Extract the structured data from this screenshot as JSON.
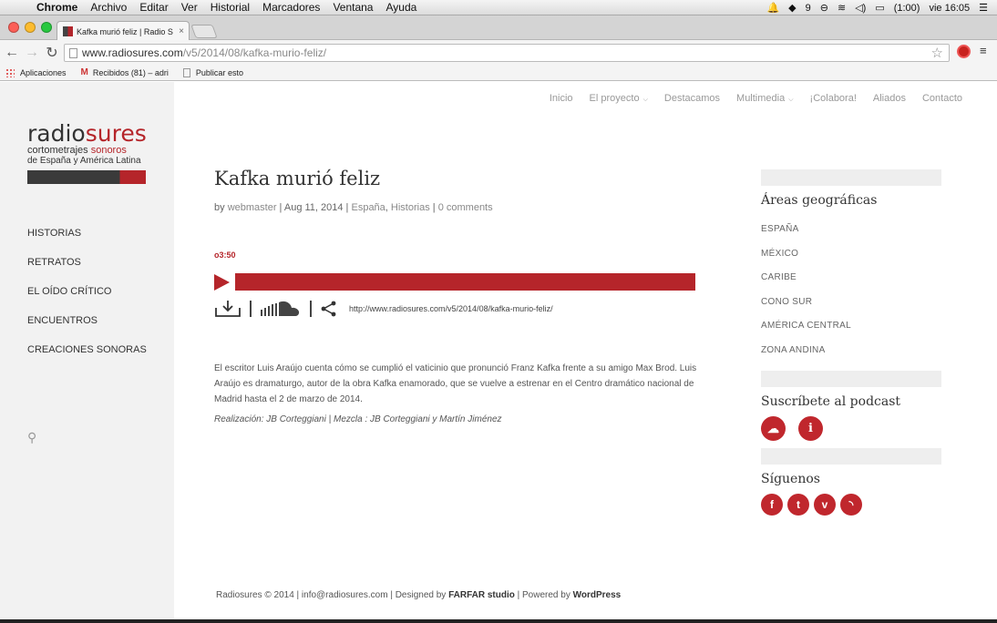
{
  "os_menubar": {
    "app": "Chrome",
    "items": [
      "Archivo",
      "Editar",
      "Ver",
      "Historial",
      "Marcadores",
      "Ventana",
      "Ayuda"
    ],
    "status": {
      "battery": "(1:00)",
      "clock": "vie 16:05",
      "notif_count": "9"
    }
  },
  "browser": {
    "tab_title": "Kafka murió feliz | Radio S",
    "url_host": "www.radiosures.com",
    "url_path": "/v5/2014/08/kafka-murio-feliz/",
    "bookmarks": [
      "Aplicaciones",
      "Recibidos (81) – adri",
      "Publicar esto"
    ]
  },
  "site": {
    "logo": {
      "word1": "radio",
      "word2": "sures",
      "tag1a": "cortometrajes",
      "tag1b": "sonoros",
      "tag2": "de España y América Latina"
    },
    "side_nav": [
      "HISTORIAS",
      "RETRATOS",
      "EL OÍDO CRÍTICO",
      "ENCUENTROS",
      "CREACIONES SONORAS"
    ],
    "top_nav": [
      "Inicio",
      "El proyecto",
      "Destacamos",
      "Multimedia",
      "¡Colabora!",
      "Aliados",
      "Contacto"
    ],
    "post": {
      "title": "Kafka murió feliz",
      "by": "by",
      "author": "webmaster",
      "date": "Aug 11, 2014",
      "cat1": "España",
      "cat2": "Historias",
      "comments": "0 comments",
      "duration": "o3:50",
      "share_url": "http://www.radiosures.com/v5/2014/08/kafka-murio-feliz/",
      "body": "El escritor Luis Araújo cuenta cómo se cumplió el vaticinio que pronunció Franz Kafka frente a su amigo Max Brod. Luis Araújo es dramaturgo, autor de la obra Kafka enamorado, que se vuelve a estrenar en el Centro dramático nacional de Madrid hasta el 2 de marzo de 2014.",
      "credit": "Realización: JB Corteggiani | Mezcla : JB Corteggiani y Martín Jiménez"
    },
    "widgets": {
      "areas_title": "Áreas geográficas",
      "areas": [
        "ESPAÑA",
        "MÉXICO",
        "CARIBE",
        "CONO SUR",
        "AMÉRICA CENTRAL",
        "ZONA ANDINA"
      ],
      "podcast_title": "Suscríbete al podcast",
      "follow_title": "Síguenos"
    },
    "footer": {
      "prefix": "Radiosures © 2014 | info@radiosures.com | Designed by",
      "designer": "FARFAR studio",
      "mid": "| Powered by",
      "platform": "WordPress"
    },
    "colors": {
      "accent": "#b5252a"
    }
  }
}
